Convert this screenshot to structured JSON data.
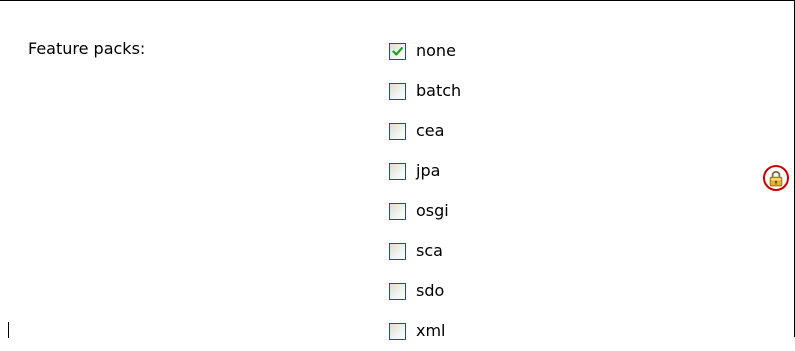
{
  "form": {
    "field_label": "Feature packs:",
    "options": [
      {
        "label": "none",
        "checked": true
      },
      {
        "label": "batch",
        "checked": false
      },
      {
        "label": "cea",
        "checked": false
      },
      {
        "label": "jpa",
        "checked": false
      },
      {
        "label": "osgi",
        "checked": false
      },
      {
        "label": "sca",
        "checked": false
      },
      {
        "label": "sdo",
        "checked": false
      },
      {
        "label": "xml",
        "checked": false
      }
    ]
  },
  "indicators": {
    "lock_icon": "padlock-icon",
    "highlight_color": "#d00000",
    "lock_color": "#d9a520"
  },
  "colors": {
    "checkbox_border": "#1c5180",
    "checkmark": "#21a121"
  }
}
